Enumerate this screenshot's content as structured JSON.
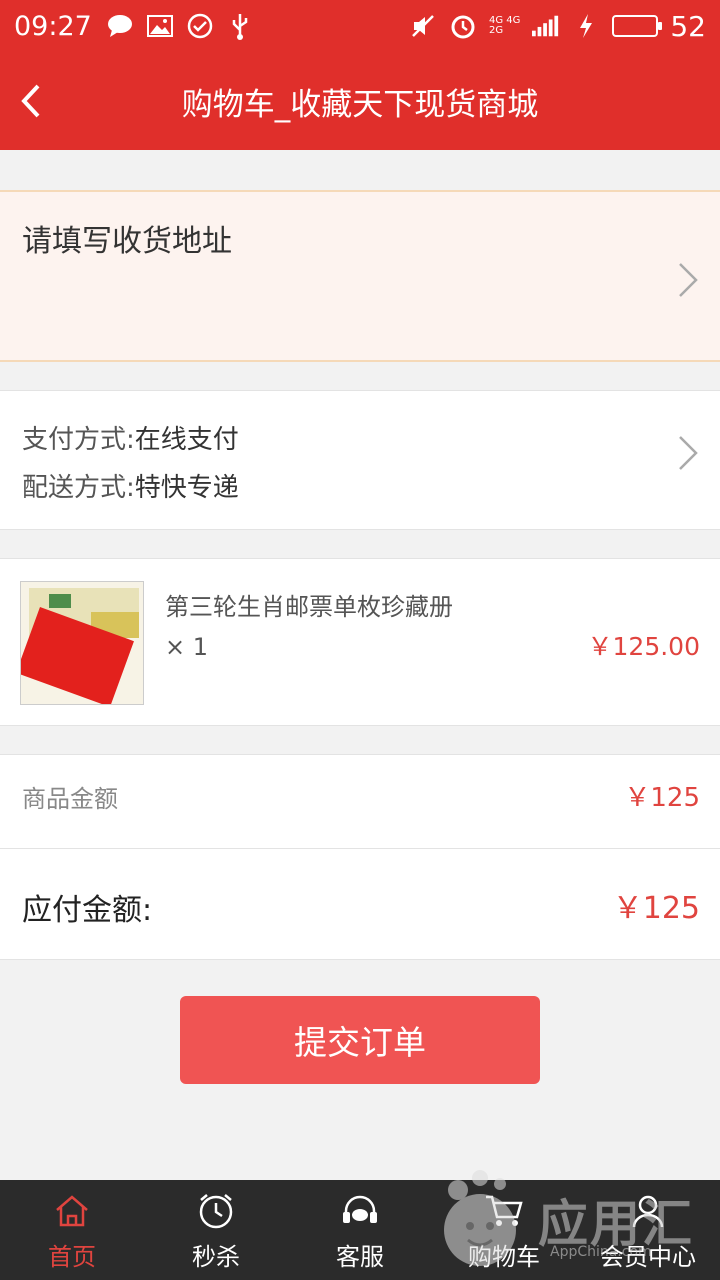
{
  "status_bar": {
    "time": "09:27",
    "battery_level": "52",
    "net_top": "4G 4G",
    "net_bottom": "2G"
  },
  "nav": {
    "title": "购物车_收藏天下现货商城"
  },
  "address": {
    "placeholder_label": "请填写收货地址"
  },
  "payment": {
    "pay_key": "支付方式:",
    "pay_value": "在线支付",
    "ship_key": "配送方式:",
    "ship_value": "特快专递"
  },
  "product": {
    "name": "第三轮生肖邮票单枚珍藏册 × 1",
    "price": "￥125.00"
  },
  "amount": {
    "goods_label": "商品金额",
    "goods_value": "￥125",
    "payable_label": "应付金额:",
    "payable_value": "￥125"
  },
  "submit": {
    "label": "提交订单"
  },
  "tabbar": {
    "items": [
      {
        "label": "首页",
        "icon": "home-icon",
        "active": true
      },
      {
        "label": "秒杀",
        "icon": "alarm-clock-icon",
        "active": false
      },
      {
        "label": "客服",
        "icon": "headset-icon",
        "active": false
      },
      {
        "label": "购物车",
        "icon": "cart-icon",
        "active": false
      },
      {
        "label": "会员中心",
        "icon": "user-icon",
        "active": false
      }
    ]
  },
  "watermark": {
    "text": "应用汇",
    "sub": "AppChina.com"
  },
  "colors": {
    "brand_red": "#e02f2b",
    "price_red": "#e0443f",
    "button_red": "#f05453"
  }
}
